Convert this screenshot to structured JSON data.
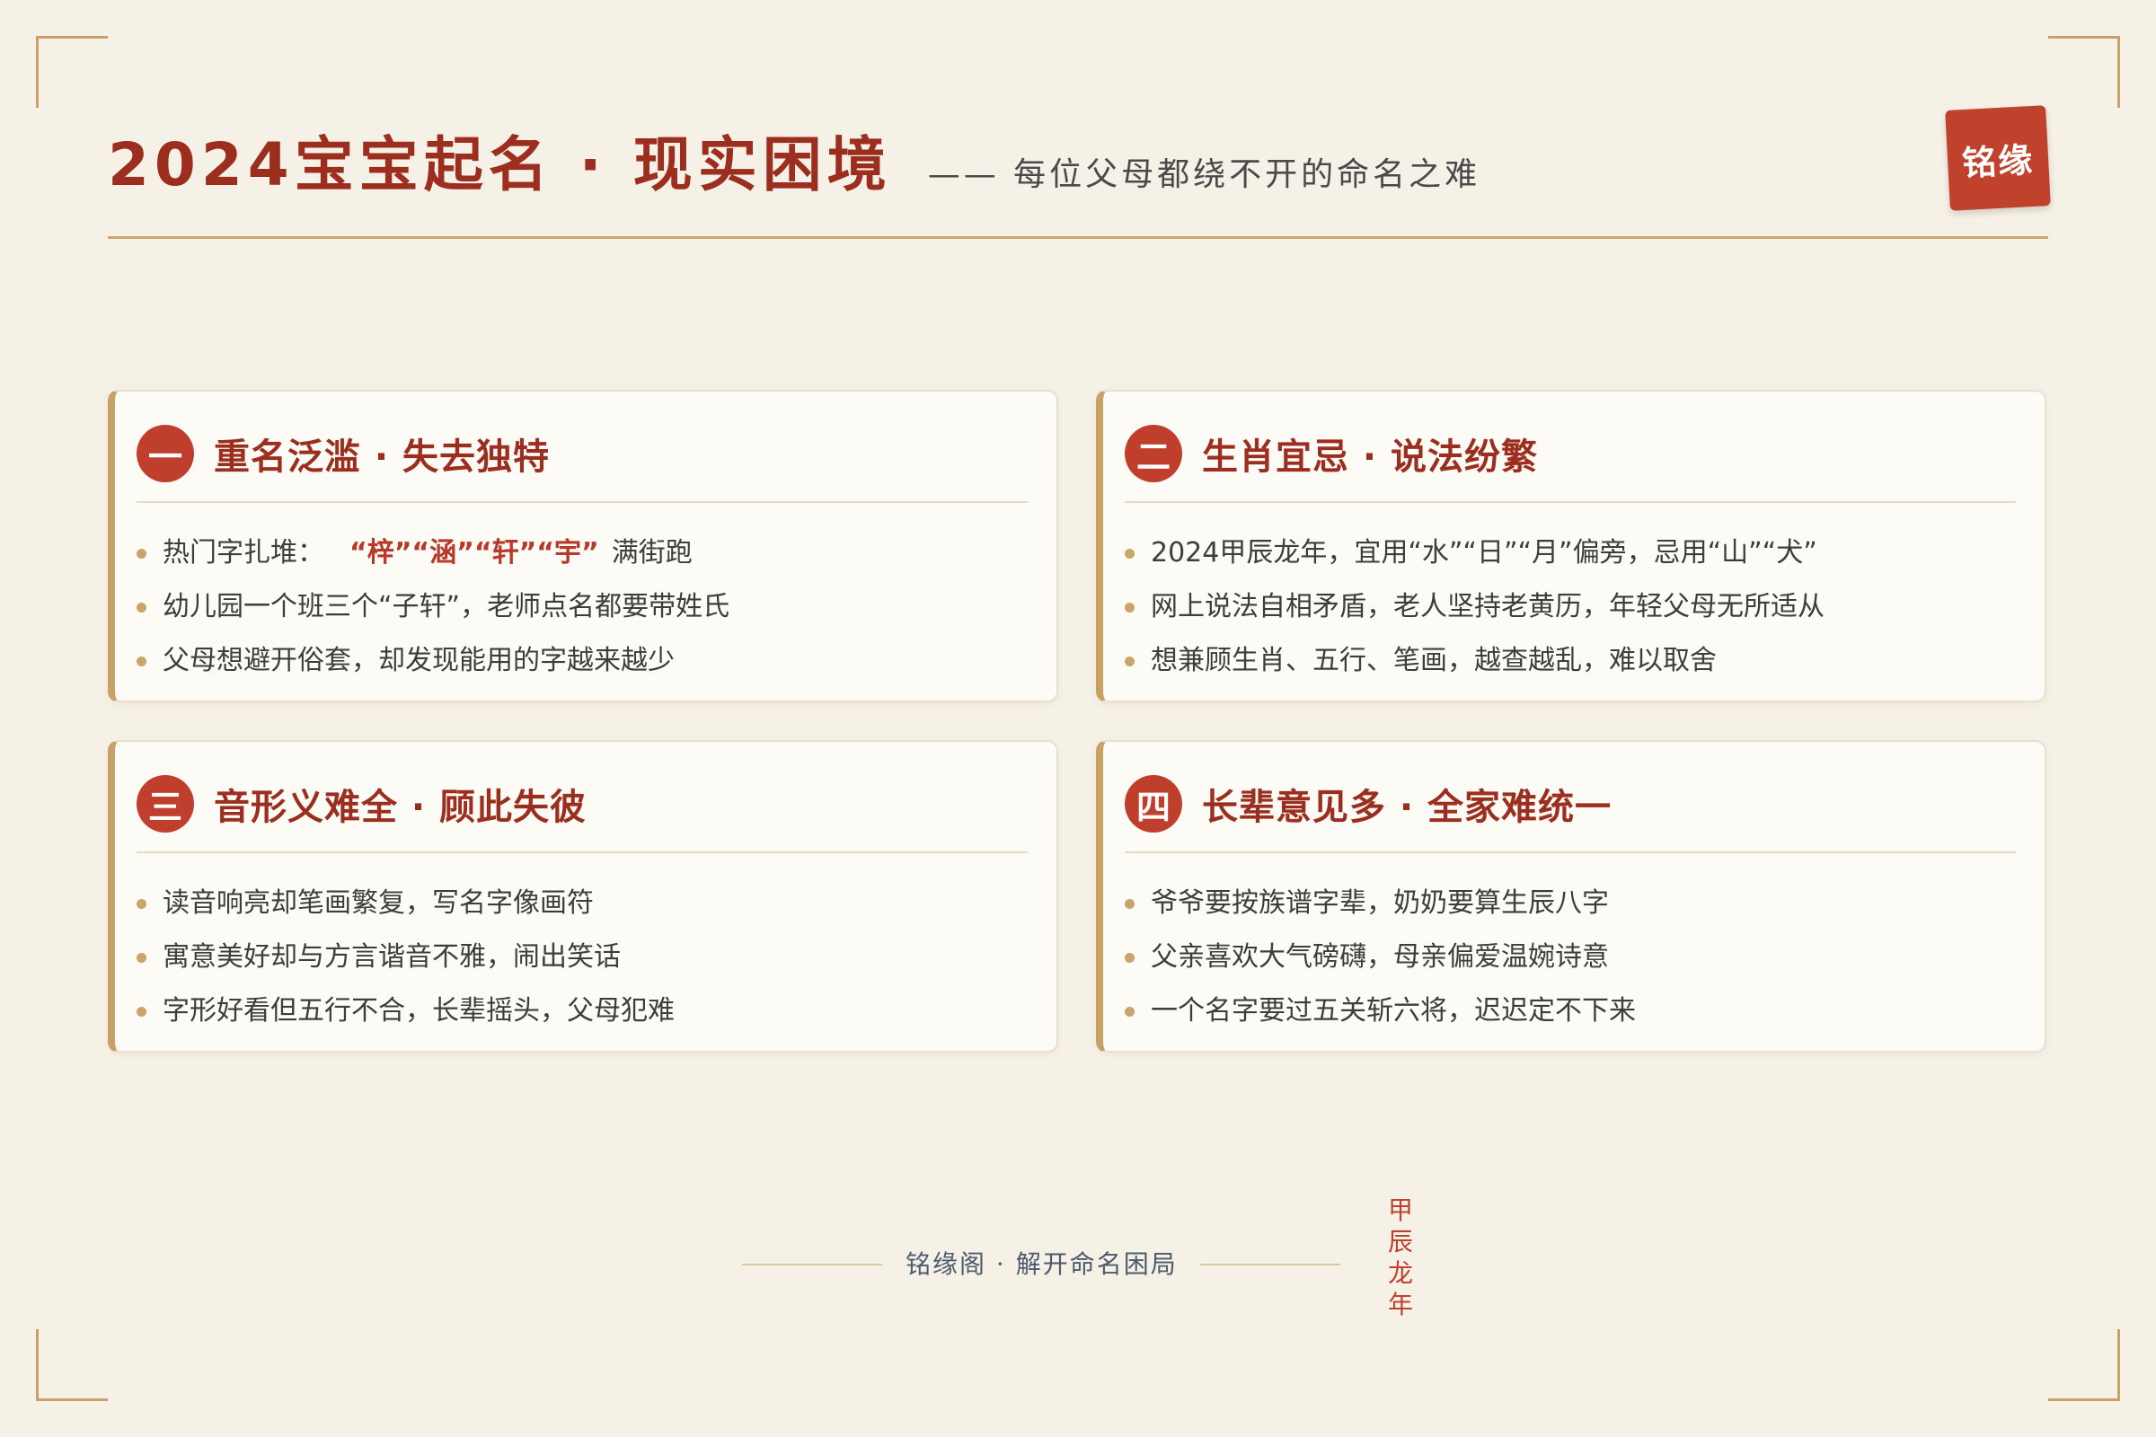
{
  "header": {
    "title": "2024宝宝起名 · 现实困境",
    "subtitle": "—— 每位父母都绕不开的命名之难",
    "seal": "铭缘"
  },
  "cards": [
    {
      "number": "一",
      "title": "重名泛滥 · 失去独特",
      "items": [
        {
          "text": "热门字扎堆：",
          "highlight": "“梓”“涵”“轩”“宇”",
          "suffix": "满街跑"
        },
        {
          "text": "幼儿园一个班三个“子轩”，老师点名都要带姓氏"
        },
        {
          "text": "父母想避开俗套，却发现能用的字越来越少"
        }
      ]
    },
    {
      "number": "二",
      "title": "生肖宜忌 · 说法纷繁",
      "items": [
        {
          "text": "2024甲辰龙年，宜用“水”“日”“月”偏旁，忌用“山”“犬”"
        },
        {
          "text": "网上说法自相矛盾，老人坚持老黄历，年轻父母无所适从"
        },
        {
          "text": "想兼顾生肖、五行、笔画，越查越乱，难以取舍"
        }
      ]
    },
    {
      "number": "三",
      "title": "音形义难全 · 顾此失彼",
      "items": [
        {
          "text": "读音响亮却笔画繁复，写名字像画符"
        },
        {
          "text": "寓意美好却与方言谐音不雅，闹出笑话"
        },
        {
          "text": "字形好看但五行不合，长辈摇头，父母犯难"
        }
      ]
    },
    {
      "number": "四",
      "title": "长辈意见多 · 全家难统一",
      "items": [
        {
          "text": "爷爷要按族谱字辈，奶奶要算生辰八字"
        },
        {
          "text": "父亲喜欢大气磅礴，母亲偏爱温婉诗意"
        },
        {
          "text": "一个名字要过五关斩六将，迟迟定不下来"
        }
      ]
    }
  ],
  "footer": {
    "text": "铭缘阁 · 解开命名困局",
    "vertical": [
      "甲",
      "辰",
      "龙",
      "年"
    ]
  },
  "colors": {
    "background": "#f6f1e7",
    "accent_red": "#bf3f2c",
    "title_red": "#9c2e1f",
    "gold": "#c8a265"
  }
}
